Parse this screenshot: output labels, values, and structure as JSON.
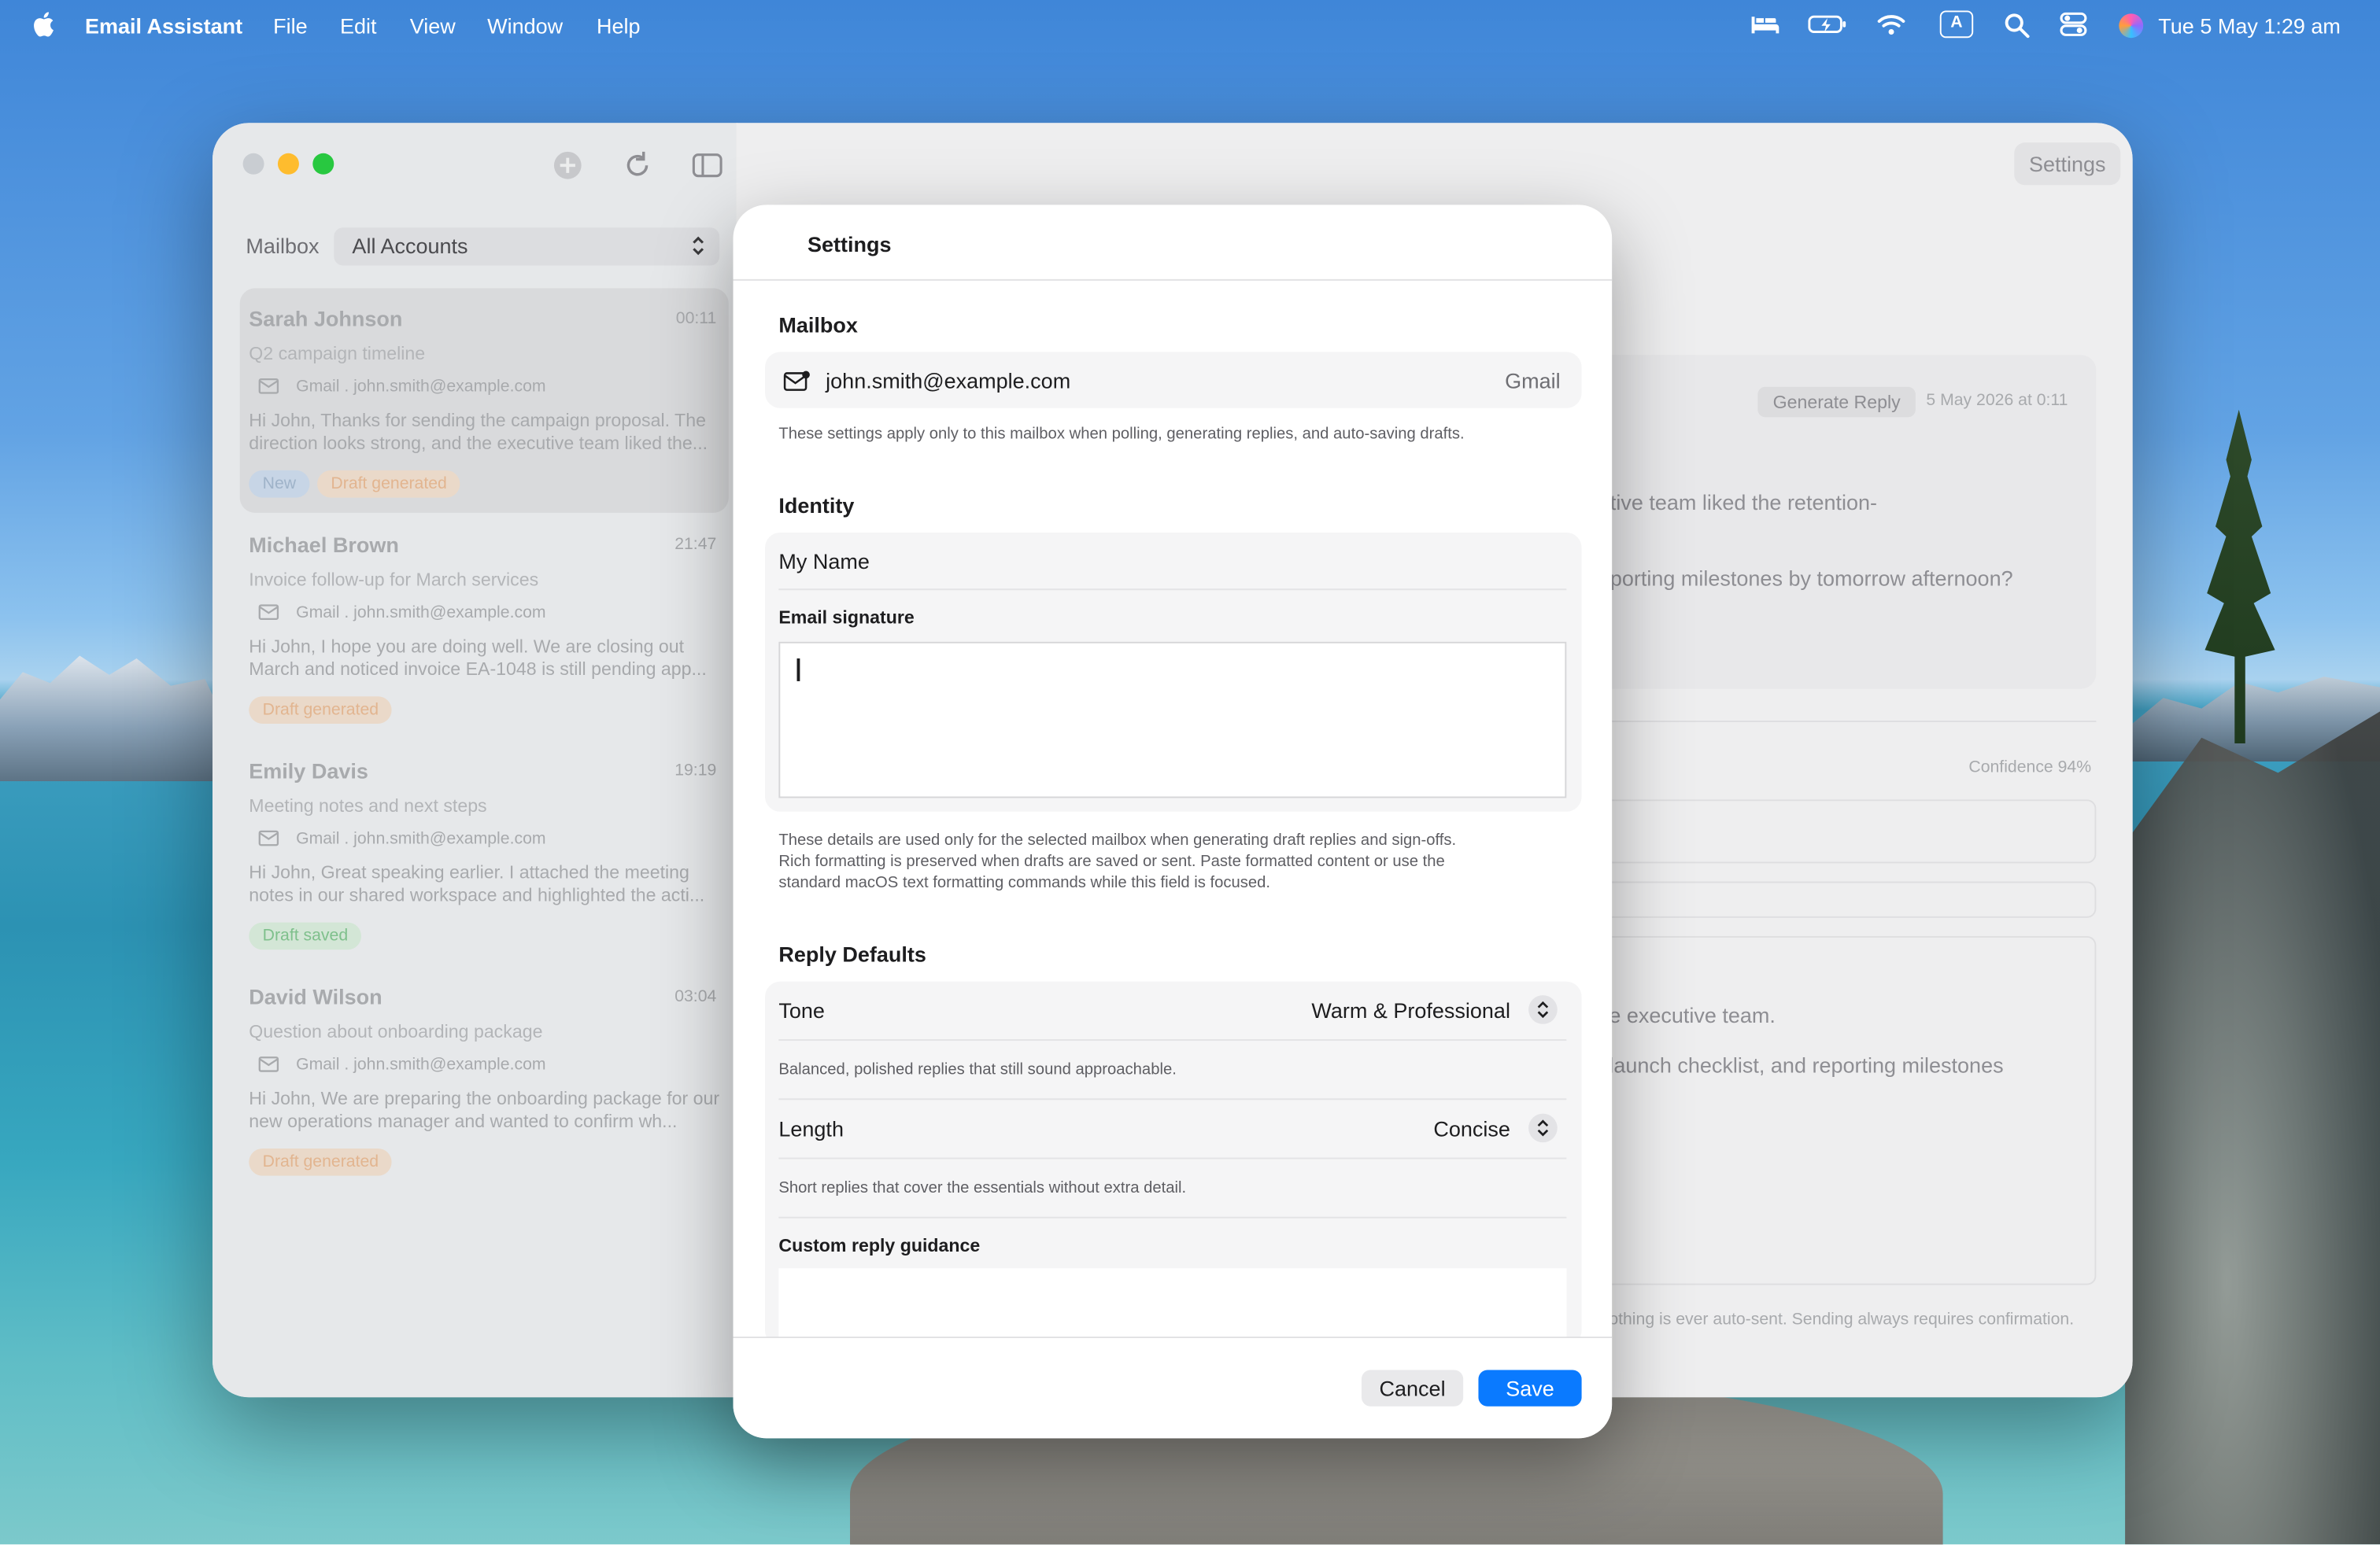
{
  "menubar": {
    "app_name": "Email Assistant",
    "items": [
      "File",
      "Edit",
      "View",
      "Window",
      "Help"
    ],
    "status_icons": [
      "bed-icon",
      "battery-icon",
      "wifi-icon",
      "input-source-icon",
      "spotlight-icon",
      "control-center-icon",
      "siri-icon"
    ],
    "input_source_letter": "A",
    "clock": "Tue 5 May  1:29 am"
  },
  "sidebar": {
    "mailbox_label": "Mailbox",
    "account_selector": "All Accounts",
    "messages": [
      {
        "from": "Sarah Johnson",
        "time": "00:11",
        "subject": "Q2 campaign timeline",
        "account": "Gmail . john.smith@example.com",
        "preview": "Hi John,  Thanks for sending the campaign proposal. The direction looks strong, and the executive team liked the...",
        "badges": [
          "New",
          "Draft generated"
        ]
      },
      {
        "from": "Michael Brown",
        "time": "21:47",
        "subject": "Invoice follow-up for March services",
        "account": "Gmail . john.smith@example.com",
        "preview": "Hi John,  I hope you are doing well. We are closing out March and noticed invoice EA-1048 is still pending app...",
        "badges": [
          "Draft generated"
        ]
      },
      {
        "from": "Emily Davis",
        "time": "19:19",
        "subject": "Meeting notes and next steps",
        "account": "Gmail . john.smith@example.com",
        "preview": "Hi John,  Great speaking earlier. I attached the meeting notes in our shared workspace and highlighted the acti...",
        "badges": [
          "Draft saved"
        ]
      },
      {
        "from": "David Wilson",
        "time": "03:04",
        "subject": "Question about onboarding package",
        "account": "Gmail . john.smith@example.com",
        "preview": "Hi John,  We are preparing the onboarding package for our new operations manager and wanted to confirm wh...",
        "badges": [
          "Draft generated"
        ]
      }
    ]
  },
  "detail": {
    "settings_button": "Settings",
    "generate_reply_button": "Generate Reply",
    "email_date": "5 May 2026 at 0:11",
    "body_line_1": "utive team liked the retention-",
    "body_line_2": "eporting milestones by tomorrow afternoon?",
    "confidence": "Confidence 94%",
    "draft_line_1": "e executive team.",
    "draft_line_2": "launch checklist, and reporting milestones",
    "footer_note": "othing is ever auto-sent. Sending always requires confirmation."
  },
  "settings": {
    "title": "Settings",
    "mailbox_section": "Mailbox",
    "mailbox_email": "john.smith@example.com",
    "mailbox_provider": "Gmail",
    "mailbox_help": "These settings apply only to this mailbox when polling, generating replies, and auto-saving drafts.",
    "identity_section": "Identity",
    "name_value": "My Name",
    "signature_label": "Email signature",
    "identity_help_1": "These details are used only for the selected mailbox when generating draft replies and sign-offs.",
    "identity_help_2": "Rich formatting is preserved when drafts are saved or sent. Paste formatted content or use the",
    "identity_help_3": "standard macOS text formatting commands while this field is focused.",
    "reply_section": "Reply Defaults",
    "tone_label": "Tone",
    "tone_value": "Warm & Professional",
    "tone_desc": "Balanced, polished replies that still sound approachable.",
    "length_label": "Length",
    "length_value": "Concise",
    "length_desc": "Short replies that cover the essentials without extra detail.",
    "guidance_label": "Custom reply guidance",
    "cancel_button": "Cancel",
    "save_button": "Save"
  },
  "colors": {
    "accent": "#0a7aff",
    "close": "#c9cdd2",
    "minimize": "#febc2e",
    "zoom": "#28c840"
  }
}
